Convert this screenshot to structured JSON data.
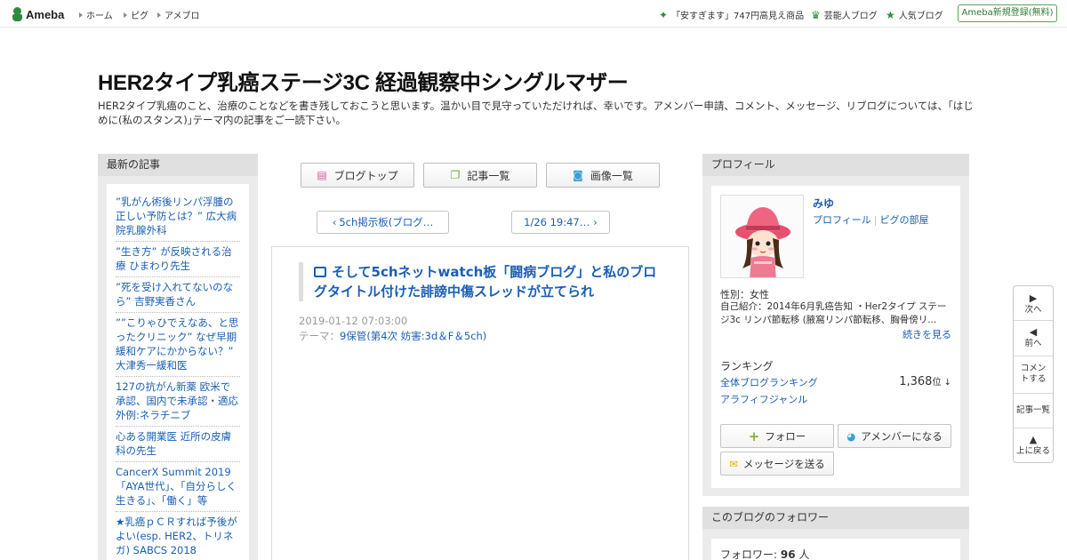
{
  "header": {
    "logo_text": "Ameba",
    "nav": [
      "ホーム",
      "ピグ",
      "アメブロ"
    ],
    "promo": "「安すぎます」747円高見え商品",
    "celeb_blog": "芸能人ブログ",
    "popular_blog": "人気ブログ",
    "register": "Ameba新規登録(無料)"
  },
  "blog": {
    "title": "HER2タイプ乳癌ステージ3C 経過観察中シングルマザー",
    "description": "HER2タイプ乳癌のこと、治療のことなどを書き残しておこうと思います。温かい目で見守っていただければ、幸いです。アメンバー申請、コメント、メッセージ、リブログについては、｢はじめに(私のスタンス)｣テーマ内の記事をご一読下さい。"
  },
  "recent": {
    "heading": "最新の記事",
    "items": [
      "”乳がん術後リンパ浮腫の正しい予防とは？” 広大病院乳腺外科",
      "”生き方” が反映される治療 ひまわり先生",
      "”死を受け入れてないのなら” 吉野実香さん",
      "””こりゃひでえなあ、と思ったクリニック” なぜ早期緩和ケアにかからない？” 大津秀一緩和医",
      "127の抗がん新薬 欧米で承認、国内で未承認・適応外例:ネラチニブ",
      "心ある開業医 近所の皮膚科の先生",
      "CancerX Summit 2019 「AYA世代」、「自分らしく生きる」、「働く」等",
      "★乳癌ｐＣＲすれば予後がよい(esp. HER2、トリネガ) SABCS 2018"
    ]
  },
  "center": {
    "buttons": {
      "blog_top": "ブログトップ",
      "article_list": "記事一覧",
      "image_list": "画像一覧"
    },
    "pager": {
      "prev": "5ch掲示板(ブログ…",
      "next": "1/26 19:47…"
    },
    "article": {
      "title": "そして5chネットwatch板「闘病ブログ」と私のブログタイトル付けた誹謗中傷スレッドが立てられ",
      "date": "2019-01-12 07:03:00",
      "theme_label": "テーマ：",
      "theme": "9保管(第4次 妨害:3d＆F＆5ch)"
    }
  },
  "profile": {
    "heading": "プロフィール",
    "name": "みゆ",
    "link_profile": "プロフィール",
    "link_pig": "ピグの部屋",
    "gender": "性別：女性",
    "intro": "自己紹介：2014年6月乳癌告知 ・Her2タイプ ステージ3c リンパ節転移 (腋窩リンパ節転移、胸骨傍リ...",
    "more": "続きを見る",
    "ranking_label": "ランキング",
    "ranking_overall": "全体ブログランキング",
    "ranking_value": "1,368",
    "ranking_unit": "位 ↓",
    "ranking_genre": "アラフィフジャンル",
    "follow": "フォロー",
    "amember": "アメンバーになる",
    "message": "メッセージを送る"
  },
  "followers": {
    "heading": "このブログのフォロワー",
    "label": "フォロワー:",
    "count": "96",
    "unit": "人"
  },
  "float_nav": {
    "next": "次へ",
    "prev": "前へ",
    "comment": "コメントする",
    "articles": "記事一覧",
    "top": "上に戻る"
  },
  "colors": {
    "brand": "#2d8c3c",
    "link": "#1a5fb4",
    "panel": "#ebebeb"
  }
}
